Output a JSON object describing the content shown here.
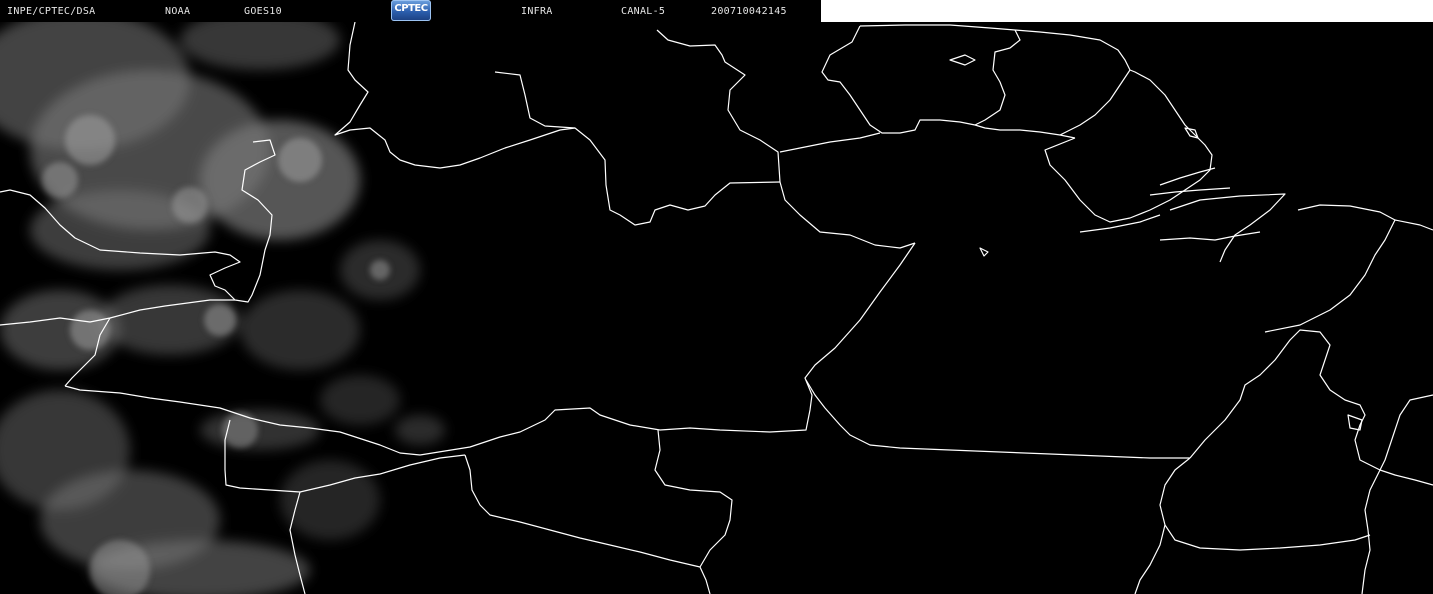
{
  "header": {
    "institution": "INPE/CPTEC/DSA",
    "agency": "NOAA",
    "satellite": "GOES10",
    "logo_text": "CPTEC",
    "product": "INFRA",
    "channel": "CANAL-5",
    "datetime": "200710042145"
  },
  "map": {
    "border_color": "#ffffff",
    "cloud_color": "#8a8a8a",
    "background_color": "#000000",
    "icon": "satellite-infrared-image"
  }
}
